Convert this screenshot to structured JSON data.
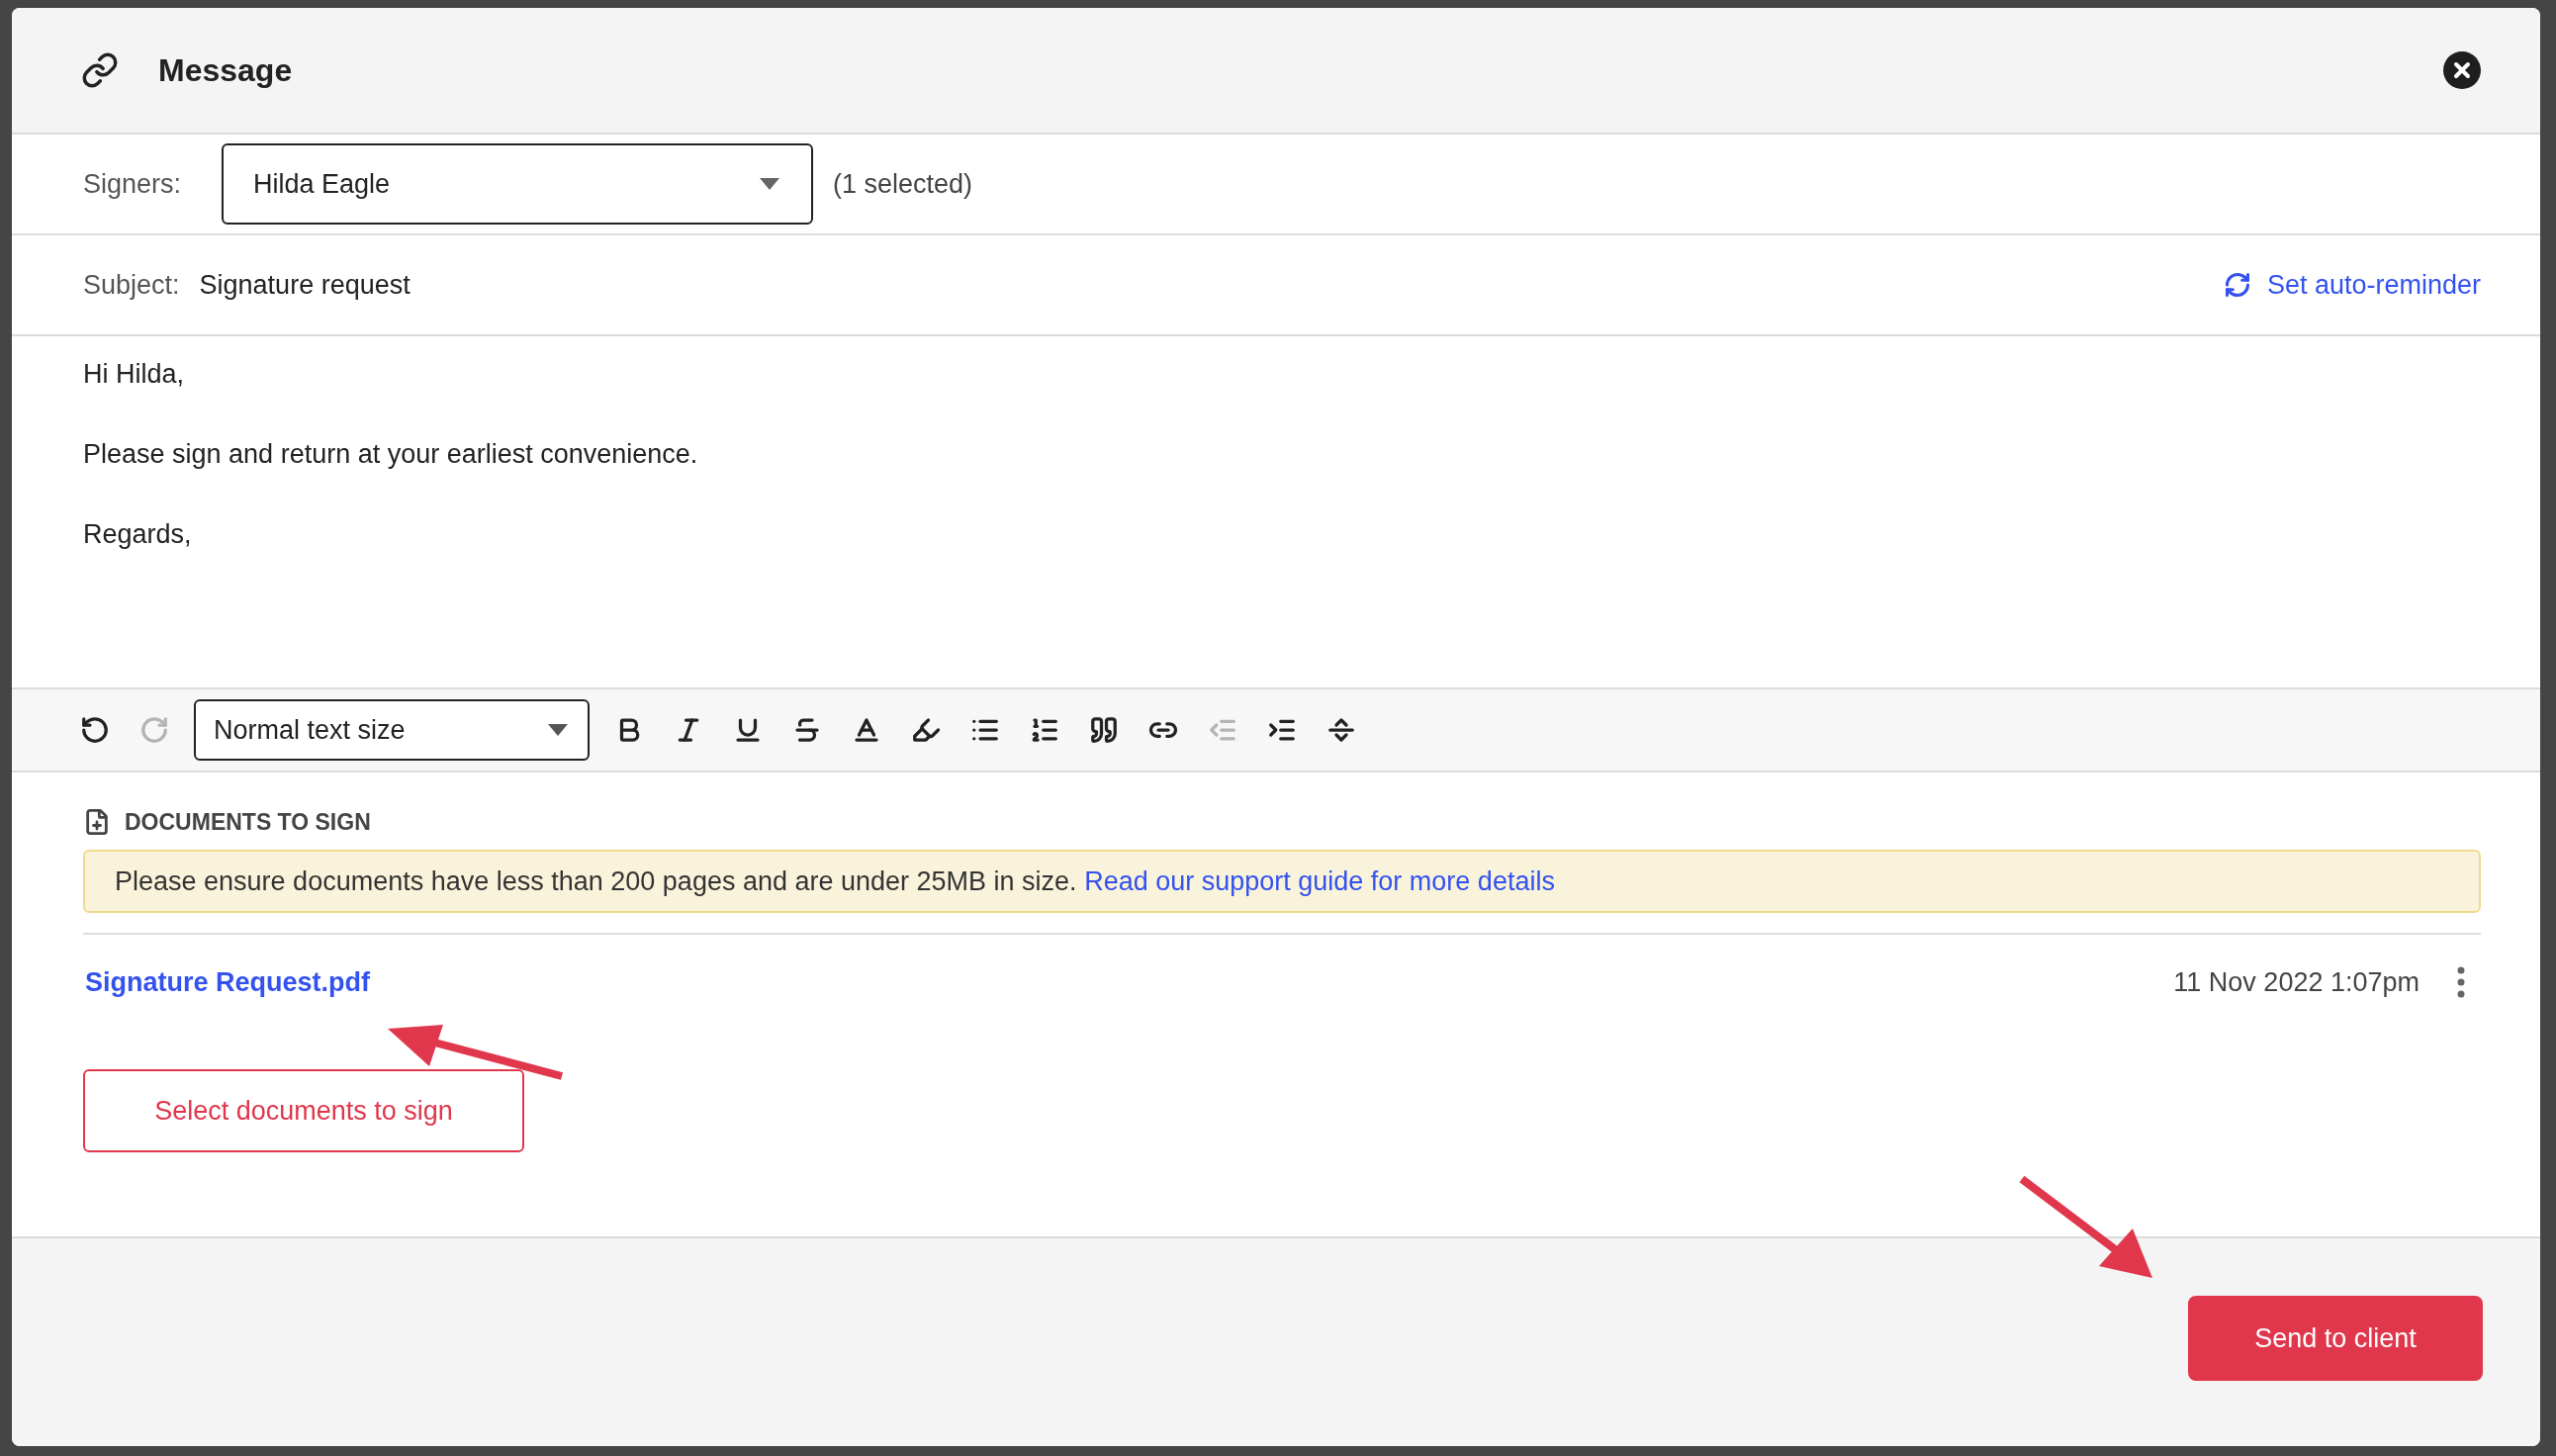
{
  "dialog": {
    "title": "Message"
  },
  "signers": {
    "label": "Signers:",
    "value": "Hilda Eagle",
    "count": "(1 selected)"
  },
  "subject": {
    "label": "Subject:",
    "value": "Signature request",
    "reminder_link": "Set auto-reminder"
  },
  "body": {
    "paragraphs": [
      "Hi Hilda,",
      "Please sign and return at your earliest convenience.",
      "Regards,"
    ]
  },
  "toolbar": {
    "text_size": "Normal text size",
    "tools": [
      {
        "kind": "undo",
        "disabled": false
      },
      {
        "kind": "redo",
        "disabled": true
      },
      {
        "kind": "size"
      },
      {
        "kind": "bold",
        "disabled": false
      },
      {
        "kind": "italic",
        "disabled": false
      },
      {
        "kind": "underline",
        "disabled": false
      },
      {
        "kind": "strike",
        "disabled": false
      },
      {
        "kind": "color",
        "disabled": false
      },
      {
        "kind": "highlight",
        "disabled": false
      },
      {
        "kind": "bullets",
        "disabled": false
      },
      {
        "kind": "numbers",
        "disabled": false
      },
      {
        "kind": "quote",
        "disabled": false
      },
      {
        "kind": "link",
        "disabled": false
      },
      {
        "kind": "outdent",
        "disabled": true
      },
      {
        "kind": "indent",
        "disabled": false
      },
      {
        "kind": "rule",
        "disabled": false
      }
    ]
  },
  "documents": {
    "heading": "DOCUMENTS TO SIGN",
    "notice": "Please ensure documents have less than 200 pages and are under 25MB in size.",
    "notice_link": "Read our support guide for more details",
    "files": [
      {
        "name": "Signature Request.pdf",
        "date": "11 Nov 2022 1:07pm"
      }
    ],
    "select_button": "Select documents to sign"
  },
  "footer": {
    "send_button": "Send to client"
  }
}
